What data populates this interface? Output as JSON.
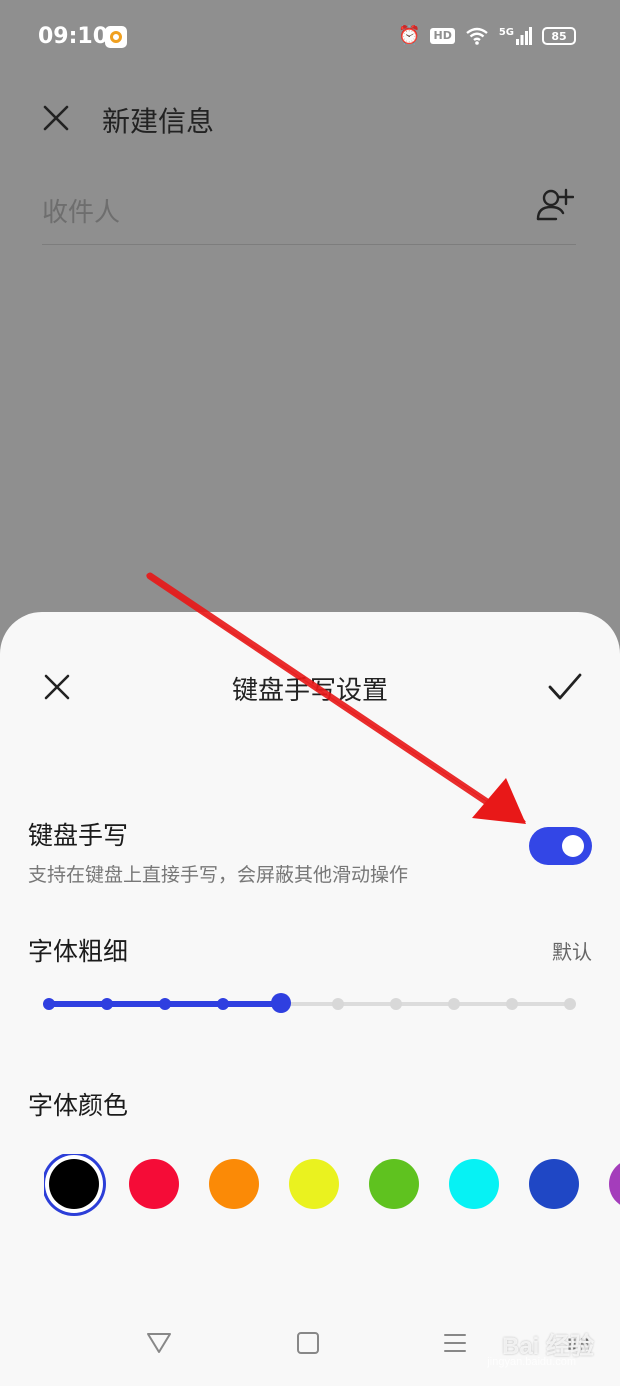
{
  "status_bar": {
    "time": "09:10",
    "hd_label": "HD",
    "network_label": "5G",
    "battery": "85",
    "icons": [
      "app-notification-icon",
      "alarm-icon",
      "hd-icon",
      "wifi-icon",
      "signal-5g-icon",
      "battery-icon"
    ]
  },
  "compose": {
    "title": "新建信息",
    "recipient_placeholder": "收件人",
    "icons": [
      "close-icon",
      "add-contact-icon"
    ]
  },
  "sheet": {
    "title": "键盘手写设置",
    "icons": [
      "close-icon",
      "check-icon"
    ],
    "handwriting": {
      "title": "键盘手写",
      "description": "支持在键盘上直接手写，会屏蔽其他滑动操作",
      "enabled": true
    },
    "font_weight": {
      "title": "字体粗细",
      "value": "默认",
      "steps": 10,
      "selected_step": 5
    },
    "font_color": {
      "title": "字体颜色",
      "colors": [
        "#000000",
        "#f50c37",
        "#fb8a06",
        "#eaf21f",
        "#5fc21f",
        "#06f2f4",
        "#1f47c5",
        "#a43dbb"
      ],
      "selected_index": 0
    }
  },
  "accent_color": "#3346e6",
  "navigation": {
    "icons": [
      "back-icon",
      "home-icon",
      "recent-apps-icon",
      "keyboard-icon"
    ]
  },
  "watermark": {
    "text": "Bai 经验",
    "subtext": "jingyan.baidu.com"
  }
}
